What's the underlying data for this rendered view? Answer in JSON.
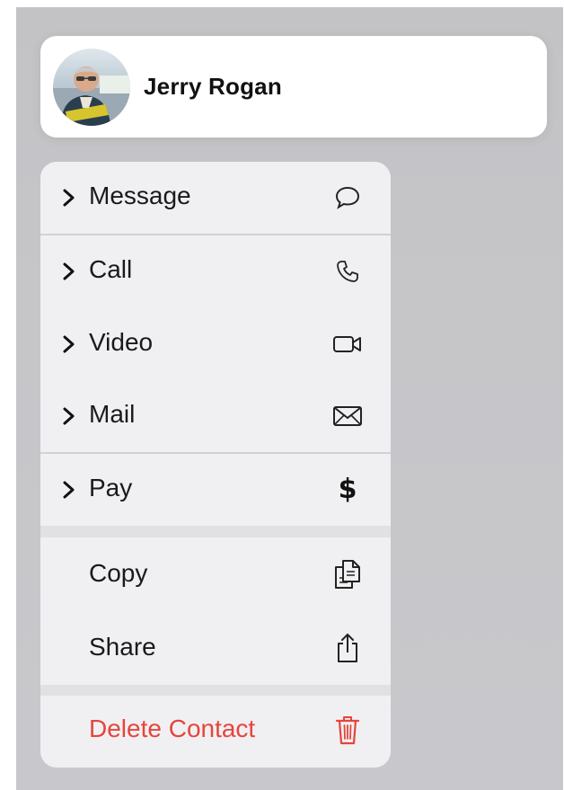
{
  "contact": {
    "name": "Jerry Rogan"
  },
  "menu": {
    "group1": [
      {
        "label": "Message",
        "icon": "speech-bubble-icon",
        "has_submenu": true
      }
    ],
    "group2": [
      {
        "label": "Call",
        "icon": "phone-icon",
        "has_submenu": true
      },
      {
        "label": "Video",
        "icon": "video-camera-icon",
        "has_submenu": true
      },
      {
        "label": "Mail",
        "icon": "envelope-icon",
        "has_submenu": true
      }
    ],
    "group3": [
      {
        "label": "Pay",
        "icon": "dollar-icon",
        "icon_glyph": "$",
        "has_submenu": true
      }
    ],
    "group4": [
      {
        "label": "Copy",
        "icon": "copy-icon",
        "has_submenu": false
      },
      {
        "label": "Share",
        "icon": "share-icon",
        "has_submenu": false
      }
    ],
    "group5": [
      {
        "label": "Delete Contact",
        "icon": "trash-icon",
        "has_submenu": false
      }
    ]
  },
  "colors": {
    "destructive": "#e5453d",
    "menu_background": "#f0f0f2",
    "separator": "#d2d2d6",
    "backdrop": "#c6c6c9"
  }
}
